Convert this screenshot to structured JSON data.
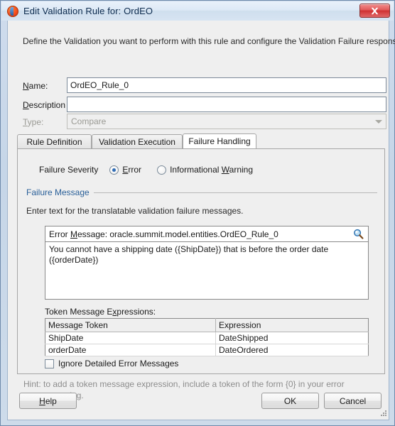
{
  "window": {
    "title": "Edit Validation Rule for: OrdEO",
    "app_icon": "oracle-round-icon",
    "close_label": "Close"
  },
  "intro": "Define the Validation you want to perform with this rule and configure the Validation Failure response.",
  "fields": {
    "name_label": "Name:",
    "name_value": "OrdEO_Rule_0",
    "description_label": "Description",
    "description_value": "",
    "description_placeholder": "",
    "type_label": "Type:",
    "type_value": "Compare"
  },
  "tabs": [
    {
      "label": "Rule Definition",
      "active": false
    },
    {
      "label": "Validation Execution",
      "active": false
    },
    {
      "label": "Failure Handling",
      "active": true
    }
  ],
  "failure_handling": {
    "severity_label": "Failure Severity",
    "severity_options": [
      {
        "label": "Error",
        "selected": true
      },
      {
        "label": "Informational Warning",
        "selected": false
      }
    ],
    "section_title": "Failure Message",
    "section_hint": "Enter text for the translatable validation failure messages.",
    "message_header": "Error Message: oracle.summit.model.entities.OrdEO_Rule_0",
    "search_icon": "magnifier-icon",
    "message_text": "You cannot have a shipping date ({ShipDate}) that is before the order date ({orderDate})",
    "token_table_label": "Token Message Expressions:",
    "token_table": {
      "columns": [
        "Message Token",
        "Expression"
      ],
      "rows": [
        [
          "ShipDate",
          "DateShipped"
        ],
        [
          "orderDate",
          "DateOrdered"
        ]
      ]
    },
    "ignore_checkbox_label": "Ignore Detailed Error Messages",
    "ignore_checkbox_checked": false
  },
  "hint": "Hint: to add a token message expression, include a token of the form {0} in your error message string.",
  "buttons": {
    "help": "Help",
    "ok": "OK",
    "cancel": "Cancel"
  },
  "colors": {
    "accent_blue": "#2a6099",
    "radio_blue": "#2f6cb5",
    "close_red": "#cf3030",
    "hint_gray": "#8d8d8d"
  }
}
